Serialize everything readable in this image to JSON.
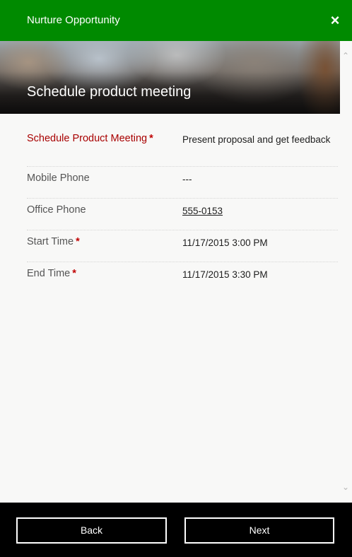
{
  "header": {
    "title": "Nurture Opportunity",
    "close_icon": "×"
  },
  "banner": {
    "heading": "Schedule product meeting"
  },
  "scroll": {
    "up_icon": "⌃",
    "down_icon": "⌄"
  },
  "fields": [
    {
      "label": "Schedule Product Meeting",
      "required": "*",
      "value": "Present proposal and get feedback"
    },
    {
      "label": "Mobile Phone",
      "value": "---"
    },
    {
      "label": "Office Phone",
      "value": "555-0153"
    },
    {
      "label": "Start Time",
      "required": "*",
      "value": "11/17/2015 3:00 PM"
    },
    {
      "label": "End Time",
      "required": "*",
      "value": "11/17/2015 3:30 PM"
    }
  ],
  "footer": {
    "back_label": "Back",
    "next_label": "Next"
  }
}
